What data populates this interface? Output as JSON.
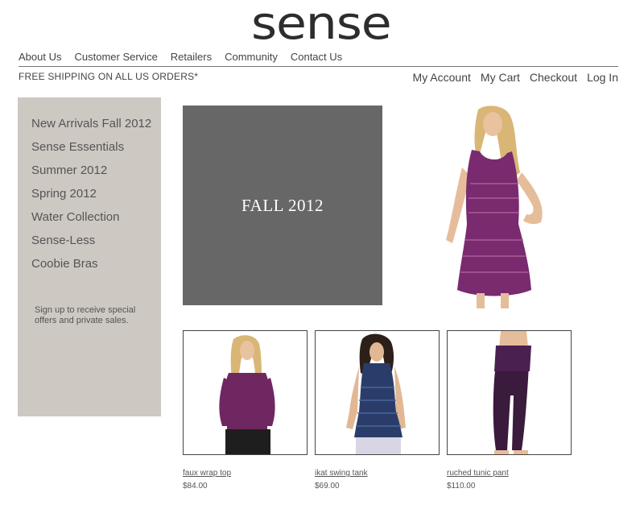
{
  "brand": {
    "logo_text": "sense"
  },
  "top_nav": [
    "About Us",
    "Customer Service",
    "Retailers",
    "Community",
    "Contact Us"
  ],
  "shipping_notice": "FREE SHIPPING ON ALL US ORDERS*",
  "account_nav": [
    "My Account",
    "My Cart",
    "Checkout",
    "Log In"
  ],
  "sidebar": {
    "items": [
      "New Arrivals Fall 2012",
      "Sense Essentials",
      "Summer 2012",
      "Spring 2012",
      "Water Collection",
      "Sense-Less",
      "Coobie Bras"
    ],
    "signup_text": "Sign up to receive special offers and private sales."
  },
  "hero": {
    "text": "FALL 2012"
  },
  "products": [
    {
      "name": "faux wrap top",
      "price": "$84.00"
    },
    {
      "name": "ikat swing tank",
      "price": "$69.00"
    },
    {
      "name": "ruched tunic pant",
      "price": "$110.00"
    }
  ],
  "colors": {
    "sidebar_bg": "#cdc8c2",
    "hero_bg": "#676767",
    "garment_purple": "#7a2a6e",
    "garment_navy": "#2a3d6a"
  }
}
